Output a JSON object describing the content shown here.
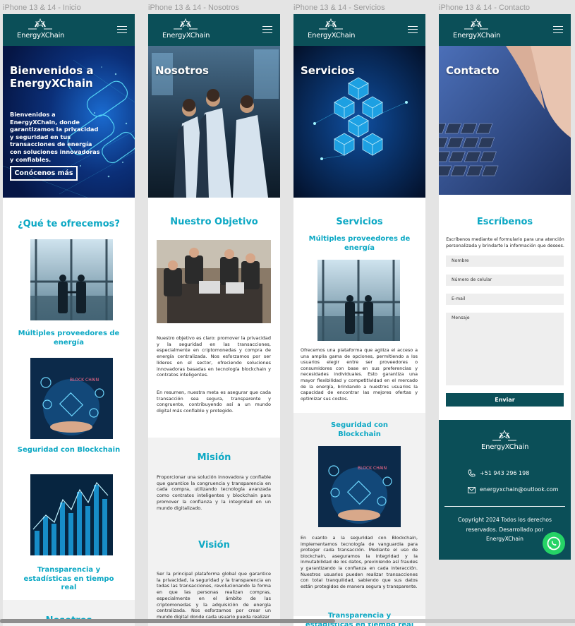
{
  "frames": {
    "inicio_label": "iPhone 13 & 14 - Inicio",
    "nosotros_label": "iPhone 13 & 14 - Nosotros",
    "servicios_label": "iPhone 13 & 14 - Servicios",
    "contacto_label": "iPhone 13 & 14 - Contacto"
  },
  "brand": {
    "name": "EnergyXChain",
    "teal": "#0b4f58",
    "accent": "#0ca8c4"
  },
  "inicio": {
    "hero_title": "Bienvenidos a EnergyXChain",
    "hero_text": "Bienvenidos a EnergyXChain, donde garantizamos la privacidad y seguridad en tus transacciones de energía con soluciones innovadoras y confiables.",
    "hero_button": "Conócenos más",
    "offer_title": "¿Qué te ofrecemos?",
    "card1_title": "Múltiples proveedores de energía",
    "card2_title": "Seguridad con Blockchain",
    "card3_title": "Transparencia y estadísticas en tiempo real",
    "next_title": "Nosotros"
  },
  "nosotros": {
    "hero_title": "Nosotros",
    "objective_title": "Nuestro Objetivo",
    "objective_p1": "Nuestro objetivo es claro: promover la privacidad y la seguridad en las transacciones, especialmente en criptomonedas y compra de energía centralizada. Nos esforzamos por ser líderes en el sector, ofreciendo soluciones innovadoras basadas en tecnología blockchain y contratos inteligentes.",
    "objective_p2": "En resumen, nuestra meta es asegurar que cada transacción sea segura, transparente y congruente, contribuyendo así a un mundo digital más confiable y protegido.",
    "mission_title": "Misión",
    "mission_text": "Proporcionar una solución innovadora y confiable que garantice la congruencia y transparencia en cada compra, utilizando tecnología avanzada como contratos inteligentes y blockchain para promover la confianza y la integridad en un mundo digitalizado.",
    "vision_title": "Visión",
    "vision_text": "Ser la principal plataforma global que garantice la privacidad, la seguridad y la transparencia en todas las transacciones, revolucionando la forma en que las personas realizan compras, especialmente en el ámbito de las criptomonedas y la adquisición de energía centralizada. Nos esforzamos por crear un mundo digital donde cada usuario pueda realizar"
  },
  "servicios": {
    "hero_title": "Servicios",
    "section_title": "Servicios",
    "s1_title": "Múltiples proveedores de energía",
    "s1_text": "Ofrecemos una plataforma que agiliza el acceso a una amplia gama de opciones, permitiendo a los usuarios elegir entre ser proveedores o consumidores con base en sus preferencias y necesidades individuales. Esto garantiza una mayor flexibilidad y competitividad en el mercado de la energía, brindando a nuestros usuarios la capacidad de encontrar las mejores ofertas y optimizar sus costos.",
    "s2_title": "Seguridad con Blockchain",
    "s2_text": "En cuanto a la seguridad con Blockchain, implementamos tecnología de vanguardia para proteger cada transacción. Mediante el uso de blockchain, aseguramos la integridad y la inmutabilidad de los datos, previniendo así fraudes y garantizando la confianza en cada interacción. Nuestros usuarios pueden realizar transacciones con total tranquilidad, sabiendo que sus datos están protegidos de manera segura y transparente.",
    "s3_title": "Transparencia y estadísticas en tiempo real"
  },
  "contacto": {
    "hero_title": "Contacto",
    "form_title": "Escríbenos",
    "form_intro": "Escríbenos mediante el formulario para una atención personalizada y brindarte la información que desees.",
    "name_placeholder": "Nombre",
    "phone_placeholder": "Número de celular",
    "email_placeholder": "E-mail",
    "message_placeholder": "Mensaje",
    "send_button": "Enviar",
    "phone": "+51 943 296 198",
    "email": "energyxchain@outlook.com",
    "copyright": "Copyright 2024 Todos los derechos reservados. Desarrollado por EnergyXChain"
  }
}
